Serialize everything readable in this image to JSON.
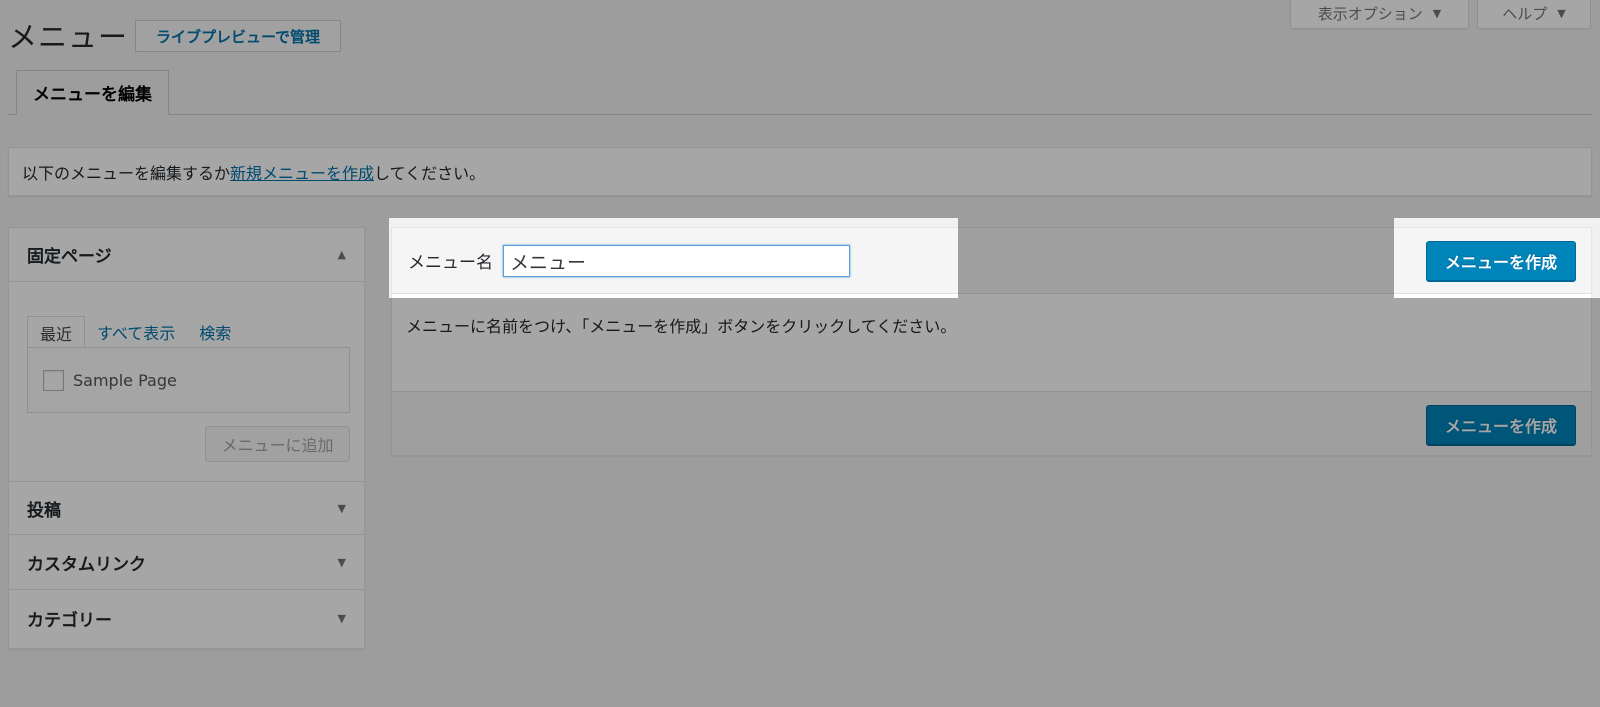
{
  "header": {
    "screen_options": "表示オプション",
    "help": "ヘルプ",
    "page_title": "メニュー",
    "live_preview_button": "ライブプレビューで管理"
  },
  "tabs": [
    {
      "label": "メニューを編集",
      "active": true
    }
  ],
  "notice": {
    "prefix": "以下のメニューを編集するか",
    "link": "新規メニューを作成",
    "suffix": "してください。"
  },
  "sidebar": {
    "sections": [
      {
        "title": "固定ページ",
        "expanded": true
      },
      {
        "title": "投稿",
        "expanded": false
      },
      {
        "title": "カスタムリンク",
        "expanded": false
      },
      {
        "title": "カテゴリー",
        "expanded": false
      }
    ],
    "inner_tabs": [
      "最近",
      "すべて表示",
      "検索"
    ],
    "items": [
      "Sample Page"
    ],
    "add_button": "メニューに追加"
  },
  "main": {
    "menu_name_label": "メニュー名",
    "menu_name_value": "メニュー",
    "create_button_top": "メニューを作成",
    "description": "メニューに名前をつけ、「メニューを作成」ボタンをクリックしてください。",
    "create_button_bottom": "メニューを作成"
  },
  "icons": {
    "expanded": "triangle-up-icon",
    "collapsed": "triangle-down-icon",
    "dropdown": "triangle-down-icon"
  },
  "colors": {
    "primary": "#0085ba",
    "link": "#0073aa",
    "background": "#f1f1f1",
    "overlay": "rgba(0,0,0,0.35)"
  }
}
